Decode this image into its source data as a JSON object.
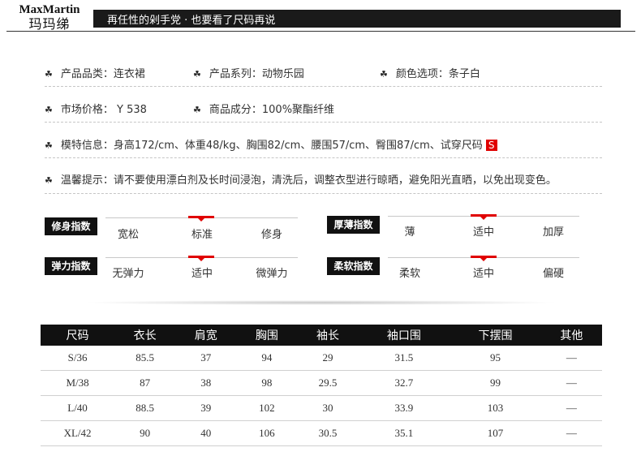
{
  "brand": {
    "name_en": "MaxMartin",
    "name_cn": "玛玛绨"
  },
  "header": {
    "slogan": "再任性的剁手党 · 也要看了尺码再说"
  },
  "info": {
    "category": "产品品类：连衣裙",
    "series": "产品系列：动物乐园",
    "color": "颜色选项：条子白",
    "price": "市场价格： Y 538",
    "material": "商品成分：100%聚酯纤维",
    "model": "模特信息：身高172/cm、体重48/kg、胸围82/cm、腰围57/cm、臀围87/cm、试穿尺码",
    "model_size": "S",
    "care": "温馨提示：请不要使用漂白剂及长时间浸泡，清洗后，调整衣型进行晾晒，避免阳光直晒，以免出现变色。",
    "bullet_icon": "clover-icon"
  },
  "indices": {
    "fit": {
      "label": "修身指数",
      "options": [
        "宽松",
        "标准",
        "修身"
      ],
      "selected": "标准"
    },
    "thickness": {
      "label": "厚薄指数",
      "options": [
        "薄",
        "适中",
        "加厚"
      ],
      "selected": "适中"
    },
    "elasticity": {
      "label": "弹力指数",
      "options": [
        "无弹力",
        "适中",
        "微弹力"
      ],
      "selected": "适中"
    },
    "softness": {
      "label": "柔软指数",
      "options": [
        "柔软",
        "适中",
        "偏硬"
      ],
      "selected": "适中"
    },
    "marker_color": "#e00000"
  },
  "size_table": {
    "headers": [
      "尺码",
      "衣长",
      "肩宽",
      "胸围",
      "袖长",
      "袖口围",
      "下摆围",
      "其他"
    ],
    "rows": [
      [
        "S/36",
        "85.5",
        "37",
        "94",
        "29",
        "31.5",
        "95",
        "—"
      ],
      [
        "M/38",
        "87",
        "38",
        "98",
        "29.5",
        "32.7",
        "99",
        "—"
      ],
      [
        "L/40",
        "88.5",
        "39",
        "102",
        "30",
        "33.9",
        "103",
        "—"
      ],
      [
        "XL/42",
        "90",
        "40",
        "106",
        "30.5",
        "35.1",
        "107",
        "—"
      ]
    ]
  }
}
